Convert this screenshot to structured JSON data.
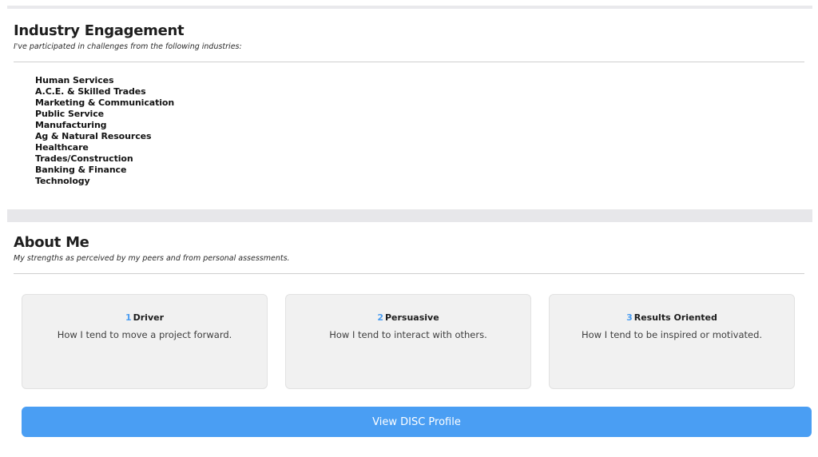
{
  "industry": {
    "title": "Industry Engagement",
    "subtitle": "I've participated in challenges from the following industries:",
    "items": [
      "Human Services",
      "A.C.E. & Skilled Trades",
      "Marketing & Communication",
      "Public Service",
      "Manufacturing",
      "Ag & Natural Resources",
      "Healthcare",
      "Trades/Construction",
      "Banking & Finance",
      "Technology"
    ]
  },
  "about": {
    "title": "About Me",
    "subtitle": "My strengths as perceived by my peers and from personal assessments.",
    "traits": [
      {
        "number": "1",
        "name": "Driver",
        "description": "How I tend to move a project forward."
      },
      {
        "number": "2",
        "name": "Persuasive",
        "description": "How I tend to interact with others."
      },
      {
        "number": "3",
        "name": "Results Oriented",
        "description": "How I tend to be inspired or motivated."
      }
    ],
    "button_label": "View DISC Profile"
  },
  "colors": {
    "accent": "#4a9ef3",
    "card_background": "#f1f1f1",
    "band": "#e7e7ea"
  }
}
